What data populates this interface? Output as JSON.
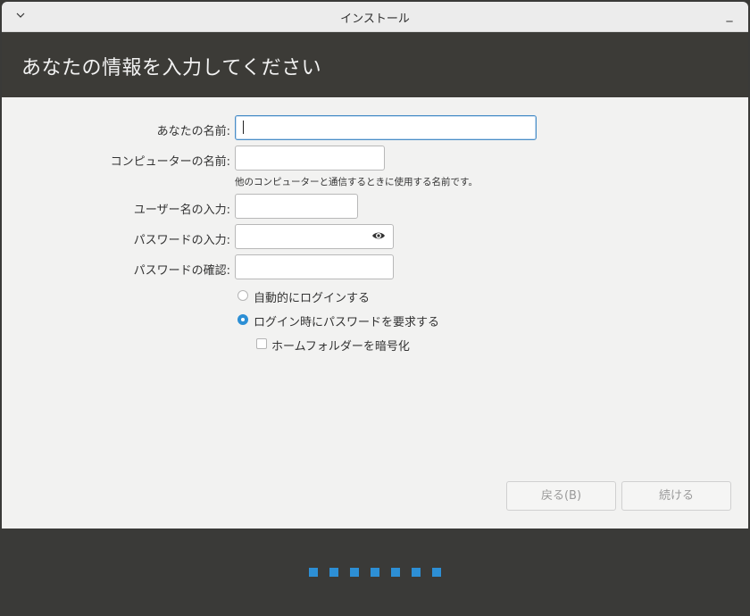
{
  "window": {
    "title": "インストール",
    "minimize_glyph": "_"
  },
  "header": {
    "title": "あなたの情報を入力してください"
  },
  "form": {
    "name_label": "あなたの名前:",
    "name_value": "",
    "computer_label": "コンピューターの名前:",
    "computer_value": "",
    "computer_hint": "他のコンピューターと通信するときに使用する名前です。",
    "username_label": "ユーザー名の入力:",
    "username_value": "",
    "password_label": "パスワードの入力:",
    "password_value": "",
    "confirm_label": "パスワードの確認:",
    "confirm_value": ""
  },
  "options": {
    "auto_login_label": "自動的にログインする",
    "auto_login_selected": false,
    "require_password_label": "ログイン時にパスワードを要求する",
    "require_password_selected": true,
    "encrypt_home_label": "ホームフォルダーを暗号化",
    "encrypt_home_checked": false
  },
  "buttons": {
    "back_label": "戻る(B)",
    "continue_label": "続ける"
  },
  "progress": {
    "dot_count": 7
  },
  "colors": {
    "accent": "#2d8fd5",
    "header_bg": "#3c3b37",
    "content_bg": "#f2f2f1"
  },
  "icons": {
    "menu": "chevron-down-icon",
    "reveal_password": "eye-icon"
  }
}
